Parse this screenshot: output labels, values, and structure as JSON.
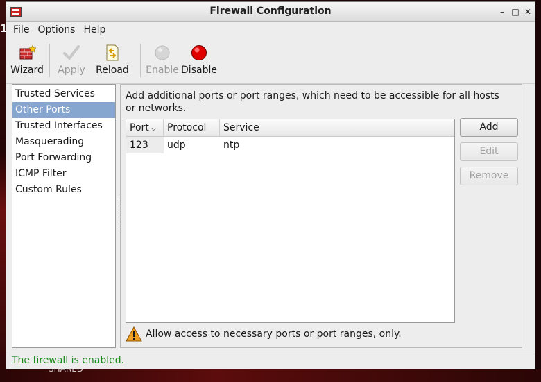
{
  "window": {
    "title": "Firewall Configuration",
    "controls": {
      "minimize": "–",
      "maximize": "□",
      "close": "✕"
    }
  },
  "menubar": {
    "items": [
      "File",
      "Options",
      "Help"
    ]
  },
  "toolbar": {
    "wizard": "Wizard",
    "apply": "Apply",
    "reload": "Reload",
    "enable": "Enable",
    "disable": "Disable"
  },
  "sidebar": {
    "items": [
      "Trusted Services",
      "Other Ports",
      "Trusted Interfaces",
      "Masquerading",
      "Port Forwarding",
      "ICMP Filter",
      "Custom Rules"
    ],
    "selected": "Other Ports"
  },
  "main": {
    "description": "Add additional ports or port ranges, which need to be accessible for all hosts or networks.",
    "columns": [
      "Port",
      "Protocol",
      "Service"
    ],
    "rows": [
      {
        "port": "123",
        "protocol": "udp",
        "service": "ntp"
      }
    ],
    "buttons": {
      "add": "Add",
      "edit": "Edit",
      "remove": "Remove"
    },
    "note": "Allow access to necessary ports or port ranges, only."
  },
  "status": "The firewall is enabled.",
  "desktop": {
    "partial_text": "SHARED",
    "edge_digit": "1"
  },
  "colors": {
    "status_text": "#1a8a1a",
    "selection": "#86a6cf",
    "disable_icon": "#e00000"
  },
  "icons": [
    "firewall-app-icon",
    "wizard-icon",
    "apply-check-icon",
    "reload-icon",
    "enable-gray-circle-icon",
    "disable-red-circle-icon",
    "warning-icon",
    "sort-down-icon"
  ]
}
